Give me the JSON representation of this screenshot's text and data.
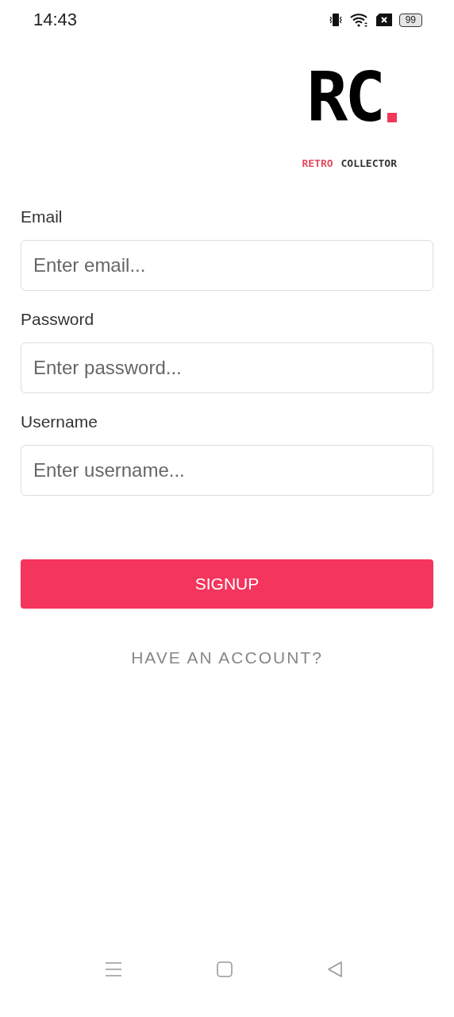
{
  "status_bar": {
    "time": "14:43",
    "battery": "99"
  },
  "logo": {
    "mark": "RC",
    "tagline_accent": "RETRO",
    "tagline": "COLLECTOR"
  },
  "fields": [
    {
      "label": "Email",
      "placeholder": "Enter email..."
    },
    {
      "label": "Password",
      "placeholder": "Enter password..."
    },
    {
      "label": "Username",
      "placeholder": "Enter username..."
    }
  ],
  "signup_button": "SIGNUP",
  "account_link": "HAVE AN ACCOUNT?"
}
